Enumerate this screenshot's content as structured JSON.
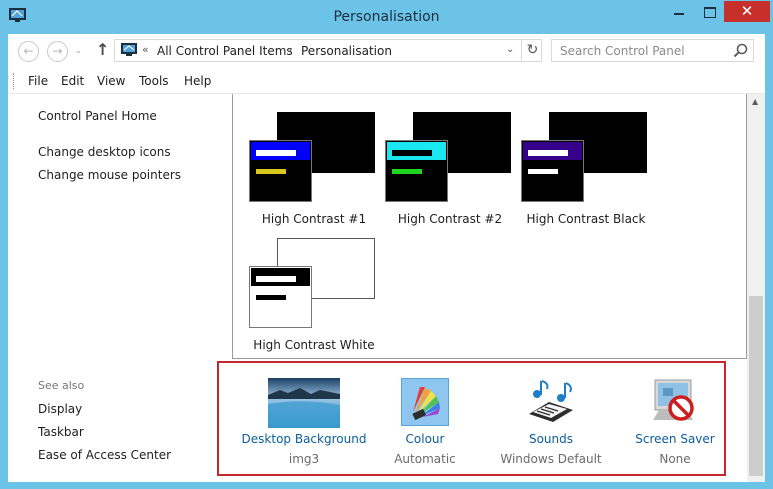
{
  "window": {
    "title": "Personalisation",
    "close_label": "✕"
  },
  "nav": {
    "back_icon": "←",
    "forward_icon": "→",
    "up_icon": "↑",
    "breadcrumb": [
      "All Control Panel Items",
      "Personalisation"
    ],
    "separator_icon": "«",
    "chevron_icon": "›",
    "dropdown_icon": "⌄",
    "refresh_icon": "↻",
    "search_placeholder": "Search Control Panel"
  },
  "menu": [
    "File",
    "Edit",
    "View",
    "Tools",
    "Help"
  ],
  "sidebar": {
    "home": "Control Panel Home",
    "links": [
      "Change desktop icons",
      "Change mouse pointers"
    ],
    "see_also_title": "See also",
    "see_also": [
      "Display",
      "Taskbar",
      "Ease of Access Center"
    ]
  },
  "themes": [
    {
      "label": "High Contrast #1",
      "back": "#000000",
      "front": "#000000",
      "header": "#0000ff",
      "bar1": "#ffffff",
      "bar2": "#d8c81c"
    },
    {
      "label": "High Contrast #2",
      "back": "#000000",
      "front": "#000000",
      "header": "#19e8f0",
      "bar1": "#000000",
      "bar2": "#20d420"
    },
    {
      "label": "High Contrast Black",
      "back": "#000000",
      "front": "#000000",
      "header": "#36008a",
      "bar1": "#ffffff",
      "bar2": "#ffffff"
    },
    {
      "label": "High Contrast White",
      "back": "#ffffff",
      "front": "#ffffff",
      "header": "#000000",
      "bar1": "#ffffff",
      "bar2": "#000000"
    }
  ],
  "settings": [
    {
      "title": "Desktop Background",
      "value": "img3",
      "icon": "landscape-icon"
    },
    {
      "title": "Colour",
      "value": "Automatic",
      "icon": "colour-swatch-icon"
    },
    {
      "title": "Sounds",
      "value": "Windows Default",
      "icon": "music-notes-icon"
    },
    {
      "title": "Screen Saver",
      "value": "None",
      "icon": "screen-saver-icon"
    }
  ],
  "colors": {
    "titlebar": "#6cc3e8",
    "close": "#c7302a",
    "link": "#0b5d9e",
    "highlight_border": "#c8282d"
  }
}
